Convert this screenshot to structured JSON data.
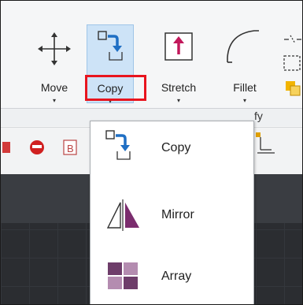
{
  "ribbon": {
    "tools": [
      {
        "label": "Move"
      },
      {
        "label": "Copy"
      },
      {
        "label": "Stretch"
      },
      {
        "label": "Fillet"
      }
    ],
    "arrow_glyph": "▾",
    "panel_title_partial": "fy"
  },
  "dropdown": {
    "items": [
      {
        "label": "Copy",
        "icon": "copy-icon"
      },
      {
        "label": "Mirror",
        "icon": "mirror-icon"
      },
      {
        "label": "Array",
        "icon": "array-icon"
      }
    ]
  },
  "colors": {
    "active_tool_bg": "#cde3f7",
    "highlight_border": "#e8141e",
    "icon_blue": "#1f6fc4",
    "icon_purple": "#7b2d6e",
    "array_light": "#b48cb0",
    "array_dark": "#6e3d6a"
  }
}
